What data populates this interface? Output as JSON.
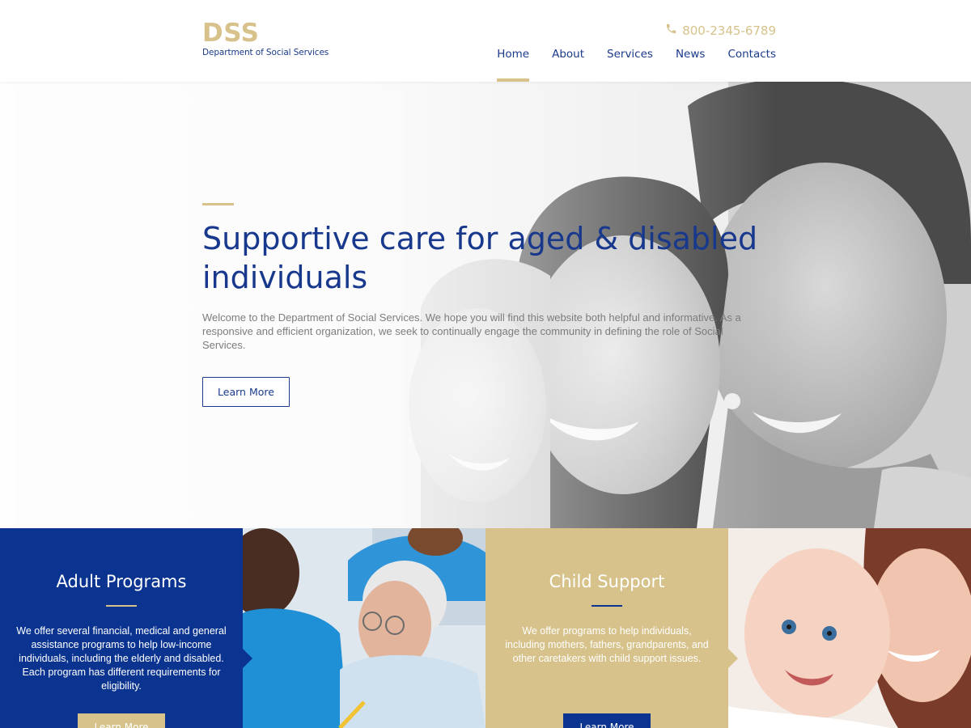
{
  "header": {
    "logo": {
      "mark": "DSS",
      "subtitle": "Department of Social Services"
    },
    "phone": {
      "icon": "phone-icon",
      "number": "800-2345-6789"
    },
    "nav": [
      {
        "label": "Home",
        "active": true
      },
      {
        "label": "About",
        "active": false
      },
      {
        "label": "Services",
        "active": false
      },
      {
        "label": "News",
        "active": false
      },
      {
        "label": "Contacts",
        "active": false
      }
    ]
  },
  "hero": {
    "title": "Supportive care for aged & disabled individuals",
    "text": "Welcome to the Department of Social Services. We hope you will find this website both helpful and informative. As a responsive and efficient organization, we seek to continually engage the community in defining the role of Social Services.",
    "button_label": "Learn More"
  },
  "features": [
    {
      "title": "Adult Programs",
      "text": "We offer several financial, medical and general assistance programs to help low-income individuals, including the elderly and disabled. Each program has different requirements for eligibility.",
      "button_label": "Learn More"
    },
    {
      "title": "Child Support",
      "text": "We offer programs to help individuals, including mothers, fathers, grandparents, and other caretakers with child support issues.",
      "button_label": "Learn More"
    }
  ],
  "colors": {
    "brand_blue": "#0b3491",
    "brand_gold": "#d6c28a",
    "heading_blue": "#17388c"
  }
}
